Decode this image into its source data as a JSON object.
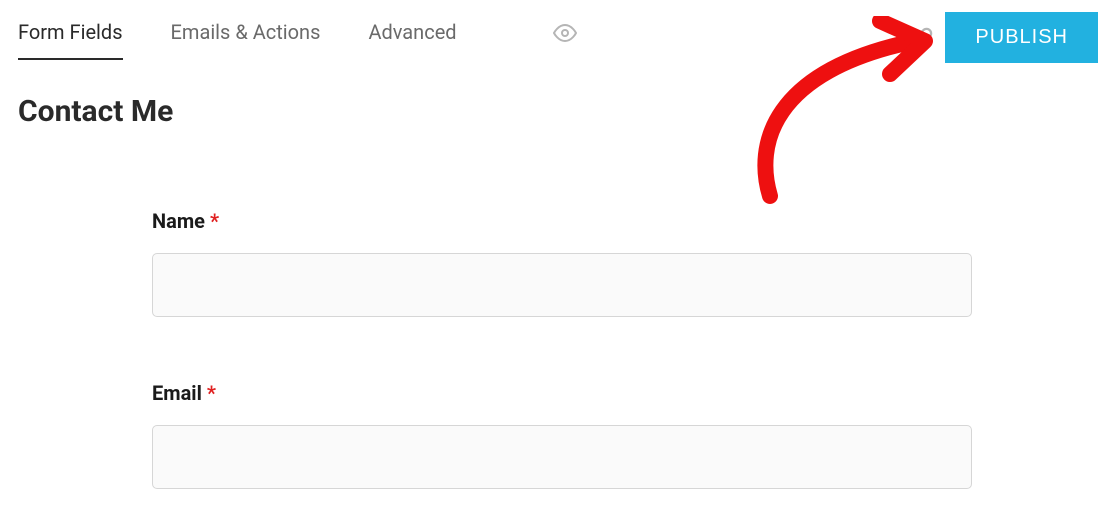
{
  "tabs": {
    "formFields": "Form Fields",
    "emailsActions": "Emails & Actions",
    "advanced": "Advanced"
  },
  "actions": {
    "publish": "PUBLISH"
  },
  "pageTitle": "Contact Me",
  "fields": {
    "name": {
      "label": "Name",
      "requiredMark": "*"
    },
    "email": {
      "label": "Email",
      "requiredMark": "*"
    }
  },
  "colors": {
    "accent": "#22b1e0",
    "annotation": "#ee1010"
  }
}
